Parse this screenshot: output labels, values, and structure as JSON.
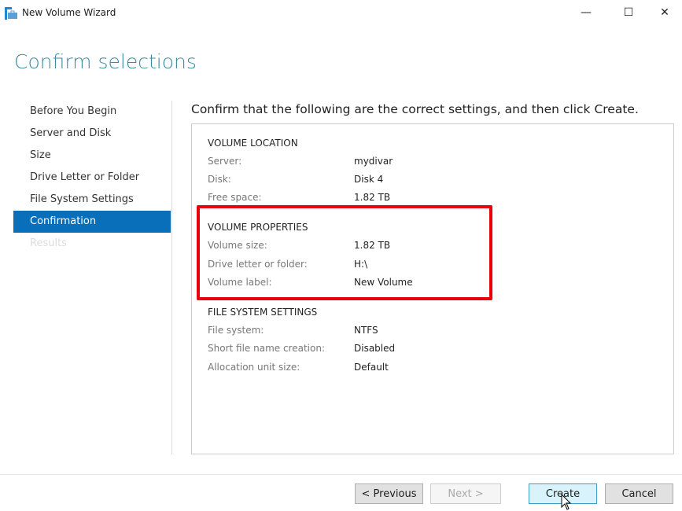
{
  "window": {
    "title": "New Volume Wizard",
    "minimize": "—",
    "maximize": "☐",
    "close": "✕"
  },
  "page_title": "Confirm selections",
  "nav": [
    {
      "label": "Before You Begin"
    },
    {
      "label": "Server and Disk"
    },
    {
      "label": "Size"
    },
    {
      "label": "Drive Letter or Folder"
    },
    {
      "label": "File System Settings"
    },
    {
      "label": "Confirmation",
      "selected": true
    },
    {
      "label": "Results",
      "disabled": true
    }
  ],
  "heading": "Confirm that the following are the correct settings, and then click Create.",
  "sections": [
    {
      "title": "VOLUME LOCATION",
      "rows": [
        {
          "label": "Server:",
          "value": "mydivar"
        },
        {
          "label": "Disk:",
          "value": "Disk 4"
        },
        {
          "label": "Free space:",
          "value": "1.82 TB"
        }
      ]
    },
    {
      "title": "VOLUME PROPERTIES",
      "rows": [
        {
          "label": "Volume size:",
          "value": "1.82 TB"
        },
        {
          "label": "Drive letter or folder:",
          "value": "H:\\"
        },
        {
          "label": "Volume label:",
          "value": "New Volume"
        }
      ]
    },
    {
      "title": "FILE SYSTEM SETTINGS",
      "rows": [
        {
          "label": "File system:",
          "value": "NTFS"
        },
        {
          "label": "Short file name creation:",
          "value": "Disabled"
        },
        {
          "label": "Allocation unit size:",
          "value": "Default"
        }
      ]
    }
  ],
  "buttons": {
    "previous": "< Previous",
    "next": "Next >",
    "create": "Create",
    "cancel": "Cancel"
  },
  "colors": {
    "accent": "#0a6fba",
    "highlight": "#e8000b",
    "title": "#3c8aa0"
  }
}
